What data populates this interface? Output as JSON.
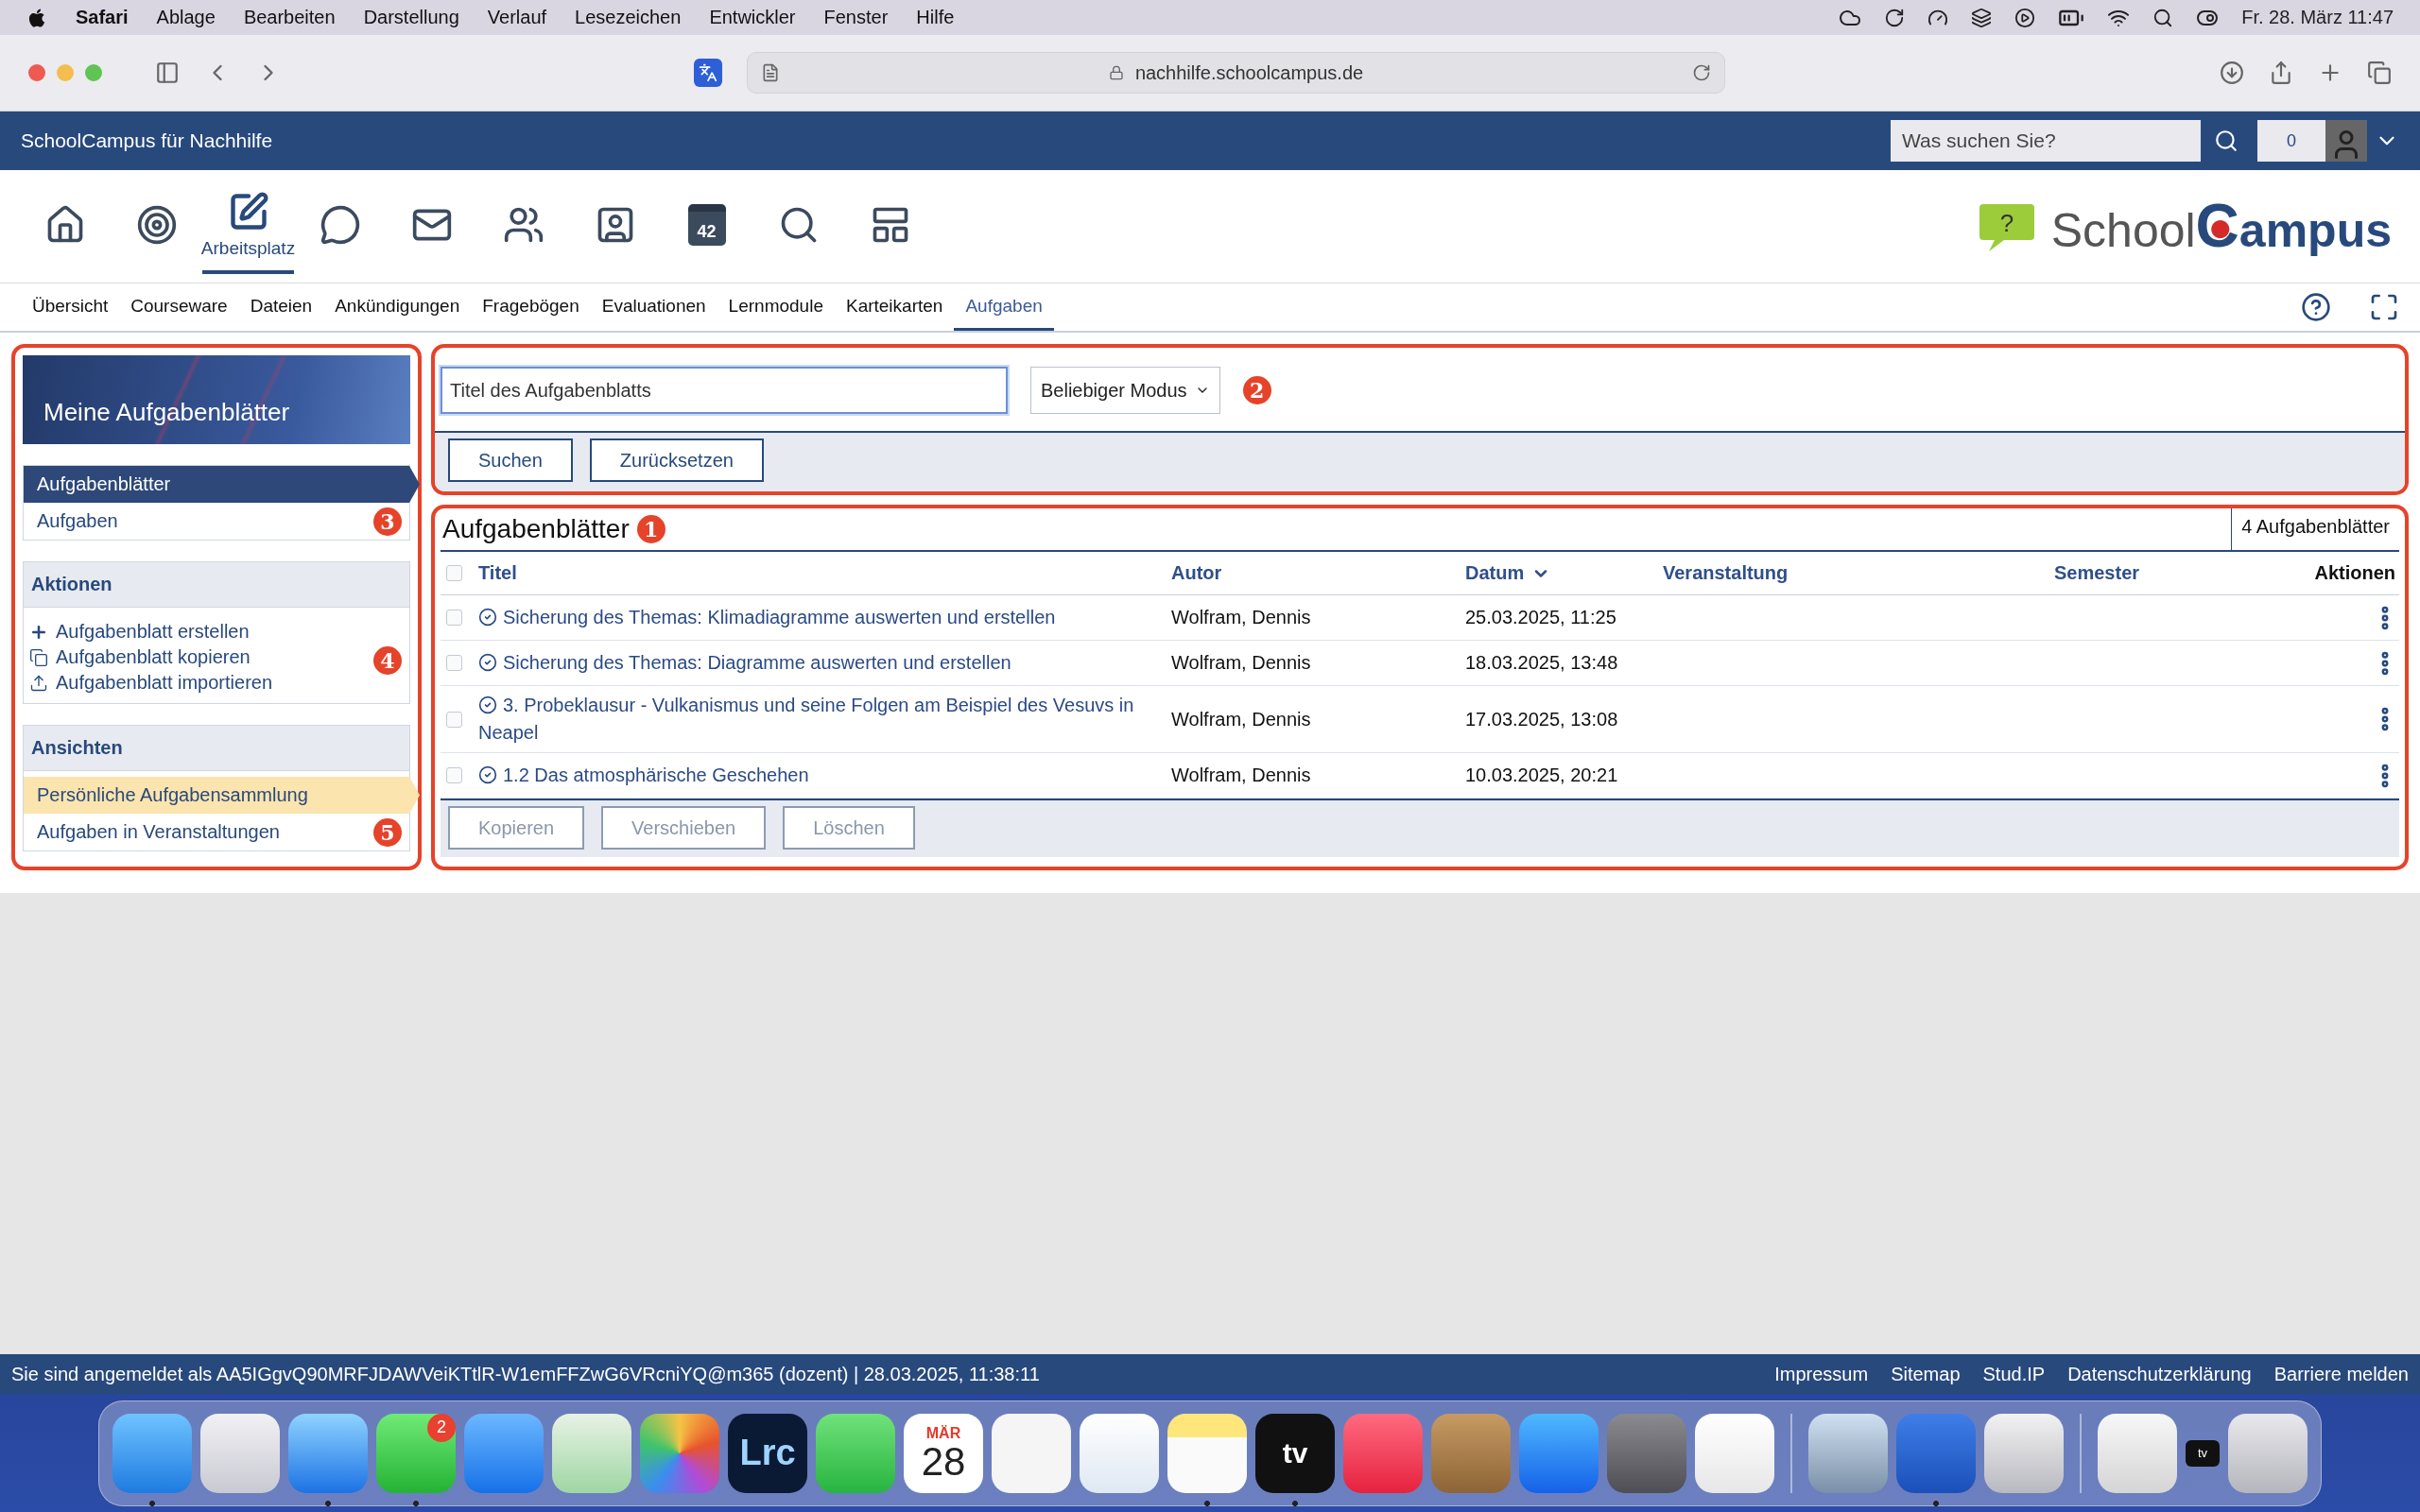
{
  "menubar": {
    "app": "Safari",
    "items": [
      "Ablage",
      "Bearbeiten",
      "Darstellung",
      "Verlauf",
      "Lesezeichen",
      "Entwickler",
      "Fenster",
      "Hilfe"
    ],
    "clock": "Fr. 28. März  11:47"
  },
  "browser": {
    "url": "nachhilfe.schoolcampus.de"
  },
  "site_header": {
    "title": "SchoolCampus für Nachhilfe",
    "search_placeholder": "Was suchen Sie?",
    "count": "0"
  },
  "main_nav": [
    {
      "selected": false
    },
    {
      "selected": false
    },
    {
      "selected": true,
      "label": "Arbeitsplatz"
    },
    {
      "selected": false
    },
    {
      "selected": false
    },
    {
      "selected": false
    },
    {
      "selected": false
    },
    {
      "selected": false,
      "day": "42"
    },
    {
      "selected": false
    },
    {
      "selected": false
    }
  ],
  "logo": {
    "bubble_mark": "?",
    "first": "School",
    "initial": "C",
    "rest": "ampus"
  },
  "tabs": [
    {
      "label": "Übersicht",
      "selected": false
    },
    {
      "label": "Courseware",
      "selected": false
    },
    {
      "label": "Dateien",
      "selected": false
    },
    {
      "label": "Ankündigungen",
      "selected": false
    },
    {
      "label": "Fragebögen",
      "selected": false
    },
    {
      "label": "Evaluationen",
      "selected": false
    },
    {
      "label": "Lernmodule",
      "selected": false
    },
    {
      "label": "Karteikarten",
      "selected": false
    },
    {
      "label": "Aufgaben",
      "selected": true
    }
  ],
  "sidebar": {
    "title": "Meine Aufgabenblätter",
    "nav": {
      "marker": "3",
      "items": [
        {
          "label": "Aufgabenblätter",
          "selected": true
        },
        {
          "label": "Aufgaben",
          "selected": false
        }
      ]
    },
    "actions": {
      "heading": "Aktionen",
      "marker": "4",
      "items": [
        {
          "label": "Aufgabenblatt erstellen"
        },
        {
          "label": "Aufgabenblatt kopieren"
        },
        {
          "label": "Aufgabenblatt importieren"
        }
      ]
    },
    "views": {
      "heading": "Ansichten",
      "marker": "5",
      "items": [
        {
          "label": "Persönliche Aufgabensammlung",
          "selected": true
        },
        {
          "label": "Aufgaben in Veranstaltungen",
          "selected": false
        }
      ]
    }
  },
  "search": {
    "placeholder": "Titel des Aufgabenblatts",
    "mode": "Beliebiger Modus",
    "marker": "2",
    "buttons": [
      "Suchen",
      "Zurücksetzen"
    ]
  },
  "table": {
    "title": "Aufgabenblätter",
    "marker": "1",
    "count": "4 Aufgabenblätter",
    "select_all": false,
    "columns": [
      {
        "label": "Titel",
        "sorted": false
      },
      {
        "label": "Autor",
        "sorted": false
      },
      {
        "label": "Datum",
        "sorted": true
      },
      {
        "label": "Veranstaltung",
        "sorted": false
      },
      {
        "label": "Semester",
        "sorted": false
      },
      {
        "label": "Aktionen",
        "sorted": false
      }
    ],
    "rows": [
      {
        "title": "Sicherung des Themas: Klimadiagramme auswerten und erstellen",
        "author": "Wolfram, Dennis",
        "date": "25.03.2025, 11:25",
        "checked": false
      },
      {
        "title": "Sicherung des Themas: Diagramme auswerten und erstellen",
        "author": "Wolfram, Dennis",
        "date": "18.03.2025, 13:48",
        "checked": false
      },
      {
        "title": "3. Probeklausur - Vulkanismus und seine Folgen am Beispiel des Vesuvs in Neapel",
        "author": "Wolfram, Dennis",
        "date": "17.03.2025, 13:08",
        "checked": false
      },
      {
        "title": "1.2 Das atmosphärische Geschehen",
        "author": "Wolfram, Dennis",
        "date": "10.03.2025, 20:21",
        "checked": false
      }
    ],
    "buttons": [
      {
        "label": "Kopieren",
        "disabled": true
      },
      {
        "label": "Verschieben",
        "disabled": true
      },
      {
        "label": "Löschen",
        "disabled": true
      }
    ]
  },
  "footer": {
    "login": "Sie sind angemeldet als AA5IGgvQ90MRFJDAWVeiKTtlR-W1emFFZwG6VRcniYQ@m365 (dozent) | 28.03.2025, 11:38:11",
    "links": [
      "Impressum",
      "Sitemap",
      "Stud.IP",
      "Datenschutzerklärung",
      "Barriere melden"
    ]
  },
  "dock": [
    {
      "kind": "app",
      "running": true
    },
    {
      "kind": "app",
      "running": false
    },
    {
      "kind": "app",
      "running": true
    },
    {
      "kind": "app",
      "running": true,
      "badge": "2"
    },
    {
      "kind": "app",
      "running": false
    },
    {
      "kind": "app",
      "running": false
    },
    {
      "kind": "app",
      "running": false
    },
    {
      "kind": "app",
      "running": false,
      "label": "Lrc"
    },
    {
      "kind": "app",
      "running": false
    },
    {
      "kind": "calendar",
      "running": false,
      "month": "MÄR",
      "day": "28"
    },
    {
      "kind": "app",
      "running": false
    },
    {
      "kind": "app",
      "running": false
    },
    {
      "kind": "app",
      "running": true
    },
    {
      "kind": "app",
      "running": true,
      "label": "tv"
    },
    {
      "kind": "app",
      "running": false
    },
    {
      "kind": "app",
      "running": false
    },
    {
      "kind": "app",
      "running": false
    },
    {
      "kind": "app",
      "running": false
    },
    {
      "kind": "app",
      "running": false
    },
    {
      "kind": "separator"
    },
    {
      "kind": "app",
      "running": false
    },
    {
      "kind": "app",
      "running": true
    },
    {
      "kind": "app",
      "running": false
    },
    {
      "kind": "separator"
    },
    {
      "kind": "app",
      "running": false
    },
    {
      "kind": "mini",
      "label": "tv"
    },
    {
      "kind": "app",
      "running": false
    }
  ]
}
